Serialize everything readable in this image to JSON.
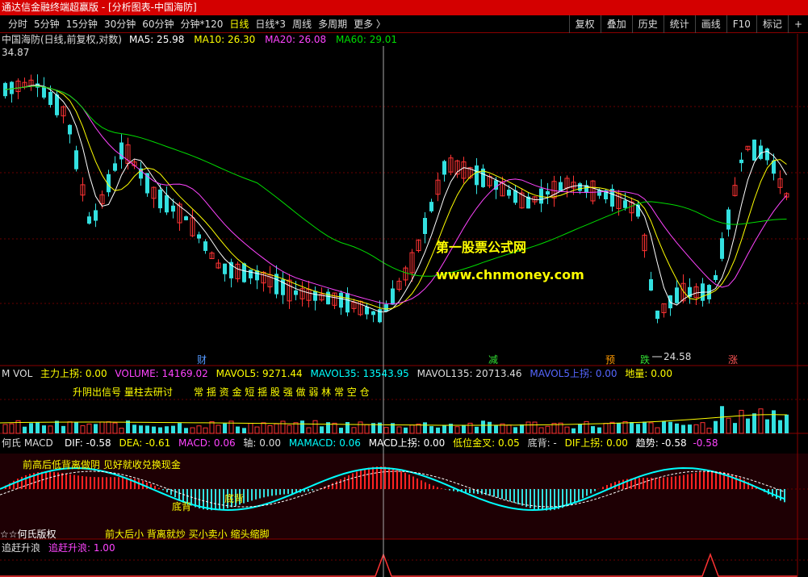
{
  "window": {
    "title": "通达信金融终端超赢版 - [分析图表-中国海防]"
  },
  "toolbar": {
    "periods": [
      "分时",
      "5分钟",
      "15分钟",
      "30分钟",
      "60分钟",
      "分钟*120",
      "日线",
      "日线*3",
      "周线",
      "多周期",
      "更多 〉"
    ],
    "active_period": "日线",
    "functions": [
      "复权",
      "叠加",
      "历史",
      "统计",
      "画线",
      "F10",
      "标记",
      "+"
    ]
  },
  "main_panel": {
    "stock_label": "中国海防(日线,前复权,对数)",
    "ma": [
      {
        "label": "MA5: 25.98",
        "color": "#ffffff"
      },
      {
        "label": "MA10: 26.30",
        "color": "#ffff00"
      },
      {
        "label": "MA20: 26.08",
        "color": "#ff44ff"
      },
      {
        "label": "MA60: 29.01",
        "color": "#00dd00"
      }
    ],
    "high_label": "34.87",
    "low_label": "24.58",
    "watermark_title": "第一股票公式网",
    "watermark_url": "www.chnmoney.com",
    "markers": [
      {
        "text": "财",
        "color": "#5599ff"
      },
      {
        "text": "减",
        "color": "#33dd33"
      },
      {
        "text": "预",
        "color": "#ff9900"
      },
      {
        "text": "跌",
        "color": "#33dd33"
      },
      {
        "text": "涨",
        "color": "#ff5555"
      }
    ]
  },
  "vol_panel": {
    "title": "M VOL",
    "stats": [
      {
        "label": "主力上拐: 0.00",
        "color": "#ffff00"
      },
      {
        "label": "VOLUME: 14169.02",
        "color": "#ff44ff"
      },
      {
        "label": "MAVOL5: 9271.44",
        "color": "#ffff00"
      },
      {
        "label": "MAVOL35: 13543.95",
        "color": "#00ffff"
      },
      {
        "label": "MAVOL135: 20713.46",
        "color": "#dddddd"
      },
      {
        "label": "MAVOL5上拐: 0.00",
        "color": "#5566ff"
      },
      {
        "label": "地量: 0.00",
        "color": "#ffff00"
      }
    ],
    "note1": "升阴出信号 量柱去研讨",
    "note2": "常 揺 资 金 短 揺 股 强 做 弱 林 常 空 仓"
  },
  "macd_panel": {
    "title": "何氏 MACD",
    "stats": [
      {
        "label": "DIF: -0.58",
        "color": "#ffffff"
      },
      {
        "label": "DEA: -0.61",
        "color": "#ffff00"
      },
      {
        "label": "MACD: 0.06",
        "color": "#ff44ff"
      },
      {
        "label": "轴: 0.00",
        "color": "#dddddd"
      },
      {
        "label": "MAMACD: 0.06",
        "color": "#00ffff"
      },
      {
        "label": "MACD上拐: 0.00",
        "color": "#ffffff"
      },
      {
        "label": "低位金叉: 0.05",
        "color": "#ffff00"
      },
      {
        "label": "底背: -",
        "color": "#dddddd"
      },
      {
        "label": "DIF上拐: 0.00",
        "color": "#ffff00"
      },
      {
        "label": "趋势: -0.58",
        "color": "#ffffff"
      },
      {
        "label": "-0.58",
        "color": "#ff44ff"
      }
    ],
    "note_top": "前高后低背离做阴  见好就收兑换现金",
    "label_dibei1": "底背",
    "label_dibei2": "底背",
    "note_bottom_left": "☆☆何氏版权",
    "note_bottom": "前大后小  背离就炒    买小卖小  缩头缩脚"
  },
  "chase_panel": {
    "title": "追赶升浪",
    "value": "追赶升浪: 1.00"
  }
}
